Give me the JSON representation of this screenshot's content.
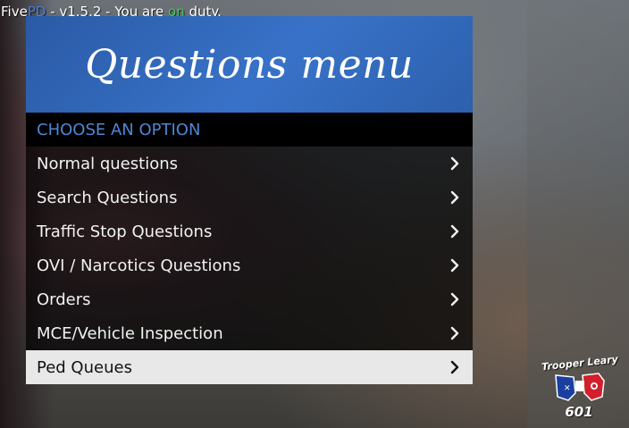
{
  "hud": {
    "prefix": "Five",
    "pd": "PD",
    "middle": " - v1.5.2 - You are ",
    "status": "on",
    "suffix": " duty."
  },
  "menu": {
    "title": "Questions menu",
    "subtitle": "CHOOSE AN OPTION",
    "selected_index": 6,
    "items": [
      {
        "label": "Normal questions",
        "icon": "chevron-right-icon"
      },
      {
        "label": "Search Questions",
        "icon": "chevron-right-icon"
      },
      {
        "label": "Traffic Stop Questions",
        "icon": "chevron-right-icon"
      },
      {
        "label": "OVI / Narcotics Questions",
        "icon": "chevron-right-icon"
      },
      {
        "label": "Orders",
        "icon": "chevron-right-icon"
      },
      {
        "label": "MCE/Vehicle Inspection",
        "icon": "chevron-right-icon"
      },
      {
        "label": "Ped Queues",
        "icon": "chevron-right-icon"
      }
    ]
  },
  "badge": {
    "name": "Trooper Leary",
    "number": "601"
  },
  "colors": {
    "banner": "#3872c8",
    "subtitle_text": "#4f86d4",
    "selected_bg": "#e8e8e8",
    "pd_accent": "#4a7ed8",
    "on_accent": "#47c45a"
  }
}
